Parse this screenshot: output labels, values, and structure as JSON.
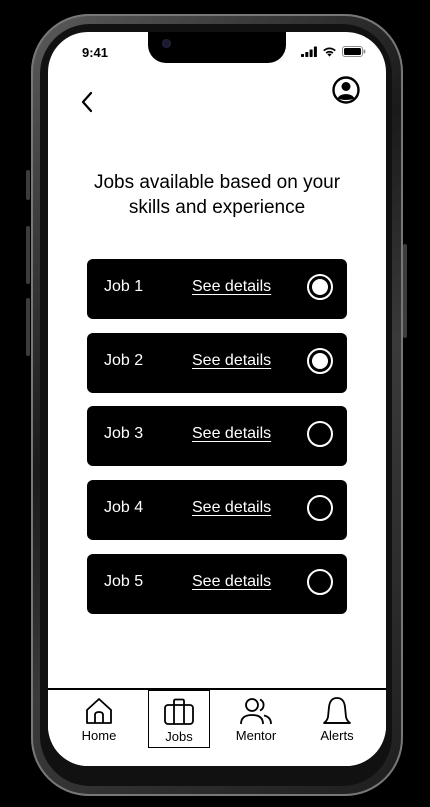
{
  "status_bar": {
    "time": "9:41",
    "icons": [
      "signal-icon",
      "wifi-icon",
      "battery-icon"
    ]
  },
  "header": {
    "back_icon": "chevron-left-icon",
    "profile_icon": "user-circle-icon"
  },
  "main": {
    "heading": "Jobs available based on your skills and experience",
    "jobs": [
      {
        "title": "Job 1",
        "link": "See details",
        "selected": true
      },
      {
        "title": "Job 2",
        "link": "See details",
        "selected": true
      },
      {
        "title": "Job 3",
        "link": "See details",
        "selected": false
      },
      {
        "title": "Job 4",
        "link": "See details",
        "selected": false
      },
      {
        "title": "Job 5",
        "link": "See details",
        "selected": false
      }
    ]
  },
  "bottom_nav": {
    "items": [
      {
        "label": "Home",
        "icon": "home-icon",
        "active": false
      },
      {
        "label": "Jobs",
        "icon": "briefcase-icon",
        "active": true
      },
      {
        "label": "Mentor",
        "icon": "users-icon",
        "active": false
      },
      {
        "label": "Alerts",
        "icon": "bell-icon",
        "active": false
      }
    ]
  },
  "colors": {
    "background": "#000000",
    "screen": "#ffffff",
    "card": "#000000",
    "card_text": "#ffffff"
  }
}
